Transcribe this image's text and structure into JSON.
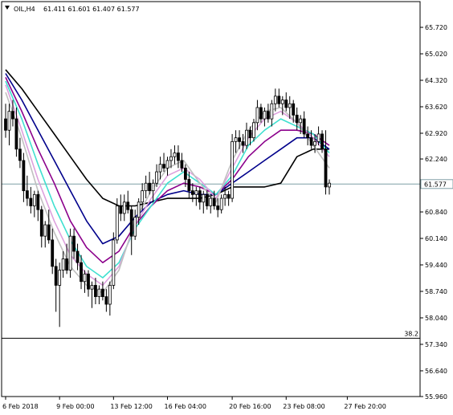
{
  "window": {
    "symbol_label": "OIL,H4",
    "ohlc": "61.411 61.601 61.407 61.577",
    "menu_icon": "triangle-down-icon"
  },
  "colors": {
    "background": "#ffffff",
    "axis": "#000000",
    "bull_body": "#ffffff",
    "bear_body": "#000000",
    "bid_line": "#7f9fa6",
    "price_tag_bg": "#ffffff",
    "ma_colors": [
      "#000000",
      "#00008b",
      "#8b008b",
      "#40e0d0",
      "#dda0dd",
      "#c0c0c0"
    ]
  },
  "chart_data": {
    "type": "candlestick",
    "symbol": "OIL",
    "timeframe": "H4",
    "ylim": [
      55.96,
      66.4
    ],
    "y_ticks": [
      "65.720",
      "65.020",
      "64.320",
      "63.620",
      "62.920",
      "62.240",
      "61.540",
      "60.840",
      "60.140",
      "59.440",
      "58.740",
      "58.040",
      "57.340",
      "56.640",
      "55.960"
    ],
    "x_ticks": [
      "6 Feb 2018",
      "9 Feb 00:00",
      "13 Feb 12:00",
      "16 Feb 04:00",
      "20 Feb 16:00",
      "23 Feb 08:00",
      "27 Feb 20:00"
    ],
    "x_tick_index": [
      0,
      15,
      30,
      45,
      63,
      78,
      95
    ],
    "current_price": "61.577",
    "current_price_value": 61.577,
    "level_label": "38.2",
    "level_value": 57.5,
    "candles": [
      [
        63.3,
        63.7,
        62.8,
        63.0
      ],
      [
        63.0,
        63.7,
        62.6,
        63.5
      ],
      [
        63.5,
        63.8,
        63.1,
        63.3
      ],
      [
        63.3,
        63.6,
        62.3,
        62.5
      ],
      [
        62.5,
        62.8,
        62.0,
        62.2
      ],
      [
        62.2,
        62.4,
        61.1,
        61.4
      ],
      [
        61.4,
        61.8,
        61.0,
        61.2
      ],
      [
        61.2,
        61.5,
        60.8,
        61.0
      ],
      [
        61.0,
        61.4,
        60.7,
        61.3
      ],
      [
        61.3,
        61.4,
        60.6,
        60.9
      ],
      [
        60.9,
        61.0,
        59.9,
        60.2
      ],
      [
        60.2,
        60.6,
        59.9,
        60.5
      ],
      [
        60.5,
        60.9,
        60.0,
        60.1
      ],
      [
        60.1,
        60.4,
        59.2,
        59.4
      ],
      [
        59.4,
        59.6,
        58.2,
        58.9
      ],
      [
        58.9,
        59.5,
        57.8,
        59.3
      ],
      [
        59.3,
        59.8,
        59.1,
        59.6
      ],
      [
        59.6,
        60.0,
        59.2,
        59.3
      ],
      [
        59.3,
        60.4,
        59.1,
        60.2
      ],
      [
        60.2,
        60.4,
        59.6,
        59.8
      ],
      [
        59.8,
        60.0,
        59.3,
        59.5
      ],
      [
        59.5,
        59.7,
        58.8,
        59.0
      ],
      [
        59.0,
        59.3,
        58.7,
        59.2
      ],
      [
        59.2,
        59.3,
        58.6,
        58.8
      ],
      [
        58.8,
        59.0,
        58.3,
        58.9
      ],
      [
        58.9,
        59.1,
        58.4,
        58.6
      ],
      [
        58.6,
        58.9,
        58.4,
        58.8
      ],
      [
        58.8,
        59.0,
        58.5,
        58.6
      ],
      [
        58.6,
        58.8,
        58.2,
        58.4
      ],
      [
        58.4,
        59.0,
        58.1,
        58.9
      ],
      [
        58.9,
        60.3,
        58.8,
        60.1
      ],
      [
        60.1,
        61.2,
        60.0,
        61.0
      ],
      [
        61.0,
        61.3,
        60.6,
        60.8
      ],
      [
        60.8,
        61.3,
        60.6,
        61.1
      ],
      [
        61.1,
        61.4,
        60.8,
        60.9
      ],
      [
        60.9,
        61.0,
        59.7,
        60.2
      ],
      [
        60.2,
        60.9,
        60.1,
        60.7
      ],
      [
        60.7,
        61.2,
        60.5,
        61.1
      ],
      [
        61.1,
        61.6,
        60.9,
        61.4
      ],
      [
        61.4,
        61.8,
        61.2,
        61.6
      ],
      [
        61.6,
        61.9,
        61.3,
        61.4
      ],
      [
        61.4,
        61.7,
        61.1,
        61.6
      ],
      [
        61.6,
        62.1,
        61.5,
        61.9
      ],
      [
        61.9,
        62.3,
        61.7,
        62.1
      ],
      [
        62.1,
        62.4,
        61.9,
        62.0
      ],
      [
        62.0,
        62.3,
        61.8,
        62.2
      ],
      [
        62.2,
        62.5,
        62.0,
        62.3
      ],
      [
        62.3,
        62.6,
        62.1,
        62.4
      ],
      [
        62.4,
        62.6,
        62.0,
        62.2
      ],
      [
        62.2,
        62.4,
        61.9,
        62.0
      ],
      [
        62.0,
        62.1,
        61.5,
        61.7
      ],
      [
        61.7,
        61.9,
        61.2,
        61.4
      ],
      [
        61.4,
        61.6,
        61.1,
        61.3
      ],
      [
        61.3,
        61.5,
        61.0,
        61.4
      ],
      [
        61.4,
        61.5,
        60.9,
        61.1
      ],
      [
        61.1,
        61.4,
        60.8,
        61.3
      ],
      [
        61.3,
        61.4,
        60.9,
        61.0
      ],
      [
        61.0,
        61.3,
        60.8,
        61.2
      ],
      [
        61.2,
        61.4,
        60.9,
        61.0
      ],
      [
        61.0,
        61.2,
        60.7,
        60.9
      ],
      [
        60.9,
        61.3,
        60.8,
        61.2
      ],
      [
        61.2,
        61.5,
        61.0,
        61.3
      ],
      [
        61.3,
        61.4,
        61.0,
        61.2
      ],
      [
        61.2,
        62.9,
        61.1,
        62.7
      ],
      [
        62.7,
        63.0,
        62.4,
        62.8
      ],
      [
        62.8,
        63.0,
        62.5,
        62.7
      ],
      [
        62.7,
        62.9,
        62.4,
        62.6
      ],
      [
        62.6,
        63.2,
        62.5,
        63.0
      ],
      [
        63.0,
        63.1,
        62.6,
        62.8
      ],
      [
        62.8,
        63.3,
        62.7,
        63.2
      ],
      [
        63.2,
        63.8,
        63.0,
        63.6
      ],
      [
        63.6,
        63.7,
        63.2,
        63.3
      ],
      [
        63.3,
        63.6,
        63.1,
        63.5
      ],
      [
        63.5,
        63.7,
        63.2,
        63.3
      ],
      [
        63.3,
        63.8,
        63.1,
        63.7
      ],
      [
        63.7,
        64.1,
        63.5,
        63.9
      ],
      [
        63.9,
        64.1,
        63.6,
        63.7
      ],
      [
        63.7,
        63.9,
        63.4,
        63.8
      ],
      [
        63.8,
        64.0,
        63.5,
        63.6
      ],
      [
        63.6,
        63.9,
        63.3,
        63.7
      ],
      [
        63.7,
        63.8,
        63.2,
        63.4
      ],
      [
        63.4,
        63.6,
        63.0,
        63.2
      ],
      [
        63.2,
        63.4,
        62.9,
        63.3
      ],
      [
        63.3,
        63.5,
        62.8,
        62.9
      ],
      [
        62.9,
        63.1,
        62.6,
        62.8
      ],
      [
        62.8,
        63.0,
        62.5,
        62.6
      ],
      [
        62.6,
        62.9,
        62.4,
        62.7
      ],
      [
        62.7,
        63.1,
        62.6,
        62.9
      ],
      [
        62.9,
        63.0,
        62.4,
        62.5
      ],
      [
        62.5,
        63.0,
        61.3,
        61.5
      ],
      [
        61.5,
        61.7,
        61.3,
        61.6
      ]
    ],
    "moving_averages": [
      {
        "color": "#000000",
        "values": [
          64.6,
          64.1,
          63.5,
          62.9,
          62.3,
          61.7,
          61.2,
          61.0,
          61.0,
          61.1,
          61.2,
          61.2,
          61.2,
          61.3,
          61.5,
          61.5,
          61.5,
          61.6,
          62.3,
          62.5,
          62.5
        ]
      },
      {
        "color": "#00008b",
        "values": [
          64.5,
          63.8,
          63.0,
          62.2,
          61.4,
          60.6,
          60.0,
          60.2,
          60.7,
          61.1,
          61.3,
          61.4,
          61.3,
          61.3,
          61.6,
          61.9,
          62.2,
          62.5,
          62.8,
          62.8,
          62.5
        ]
      },
      {
        "color": "#8b008b",
        "values": [
          64.4,
          63.5,
          62.5,
          61.6,
          60.6,
          59.9,
          59.5,
          59.8,
          60.5,
          61.0,
          61.4,
          61.6,
          61.5,
          61.3,
          61.7,
          62.3,
          62.7,
          63.0,
          63.0,
          62.9,
          62.6
        ]
      },
      {
        "color": "#40e0d0",
        "values": [
          64.3,
          63.3,
          62.1,
          61.0,
          60.1,
          59.4,
          59.1,
          59.5,
          60.4,
          61.0,
          61.6,
          61.9,
          61.6,
          61.3,
          61.8,
          62.6,
          63.0,
          63.3,
          63.1,
          62.9,
          62.4
        ]
      },
      {
        "color": "#dda0dd",
        "values": [
          64.2,
          63.0,
          61.7,
          60.6,
          59.7,
          59.2,
          58.9,
          59.4,
          60.5,
          61.2,
          61.8,
          62.0,
          61.7,
          61.2,
          62.0,
          62.8,
          63.3,
          63.5,
          63.2,
          62.8,
          62.3
        ]
      },
      {
        "color": "#c0c0c0",
        "values": [
          64.0,
          62.8,
          61.4,
          60.3,
          59.4,
          58.9,
          58.7,
          59.3,
          60.6,
          61.4,
          62.0,
          62.2,
          61.6,
          61.1,
          62.2,
          63.0,
          63.5,
          63.6,
          63.2,
          62.6,
          62.0
        ]
      }
    ]
  }
}
